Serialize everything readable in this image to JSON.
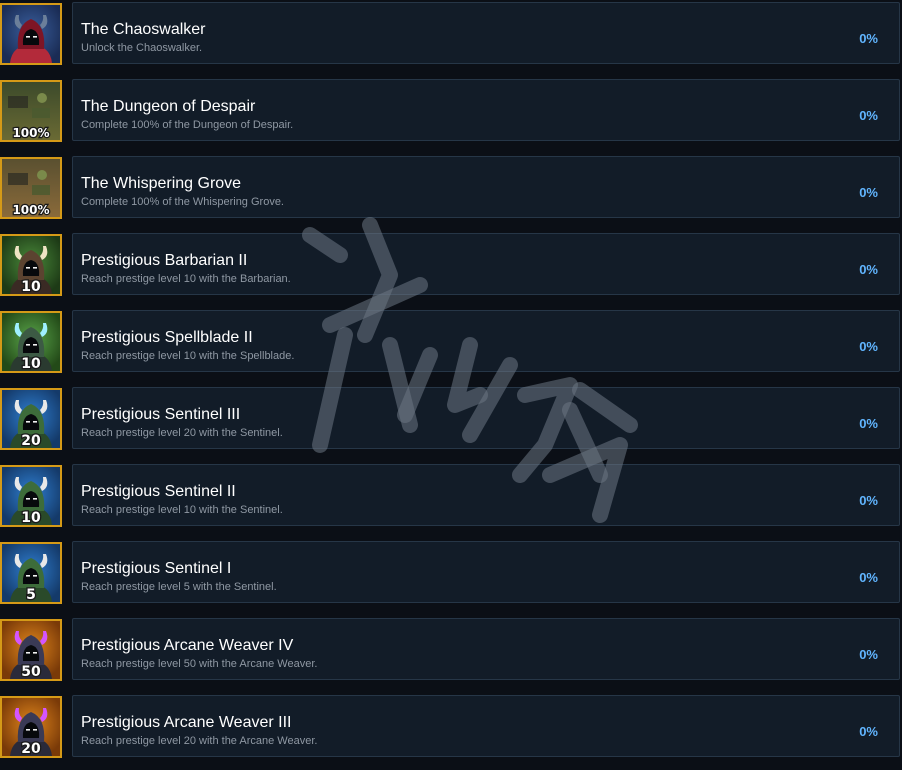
{
  "achievements": [
    {
      "title": "The Chaoswalker",
      "description": "Unlock the Chaoswalker.",
      "progress": "0%",
      "icon": "chaoswalker-icon",
      "icon_label": ""
    },
    {
      "title": "The Dungeon of Despair",
      "description": "Complete 100% of the Dungeon of Despair.",
      "progress": "0%",
      "icon": "dungeon-map-icon",
      "icon_label": "100%"
    },
    {
      "title": "The Whispering Grove",
      "description": "Complete 100% of the Whispering Grove.",
      "progress": "0%",
      "icon": "grove-map-icon",
      "icon_label": "100%"
    },
    {
      "title": "Prestigious Barbarian II",
      "description": "Reach prestige level 10 with the Barbarian.",
      "progress": "0%",
      "icon": "barbarian-icon",
      "icon_label": "10"
    },
    {
      "title": "Prestigious Spellblade II",
      "description": "Reach prestige level 10 with the Spellblade.",
      "progress": "0%",
      "icon": "spellblade-icon",
      "icon_label": "10"
    },
    {
      "title": "Prestigious Sentinel III",
      "description": "Reach prestige level 20 with the Sentinel.",
      "progress": "0%",
      "icon": "sentinel-icon",
      "icon_label": "20"
    },
    {
      "title": "Prestigious Sentinel II",
      "description": "Reach prestige level 10 with the Sentinel.",
      "progress": "0%",
      "icon": "sentinel-icon",
      "icon_label": "10"
    },
    {
      "title": "Prestigious Sentinel I",
      "description": "Reach prestige level 5 with the Sentinel.",
      "progress": "0%",
      "icon": "sentinel-icon",
      "icon_label": "5"
    },
    {
      "title": "Prestigious Arcane Weaver IV",
      "description": "Reach prestige level 50 with the Arcane Weaver.",
      "progress": "0%",
      "icon": "arcane-weaver-icon",
      "icon_label": "50"
    },
    {
      "title": "Prestigious Arcane Weaver III",
      "description": "Reach prestige level 20 with the Arcane Weaver.",
      "progress": "0%",
      "icon": "arcane-weaver-icon",
      "icon_label": "20"
    }
  ],
  "colors": {
    "background": "#0b0f16",
    "panel": "#121c28",
    "panel_border": "#263647",
    "icon_frame": "#d59a17",
    "title": "#ffffff",
    "description": "#8f98a3",
    "progress": "#61b5ff"
  }
}
